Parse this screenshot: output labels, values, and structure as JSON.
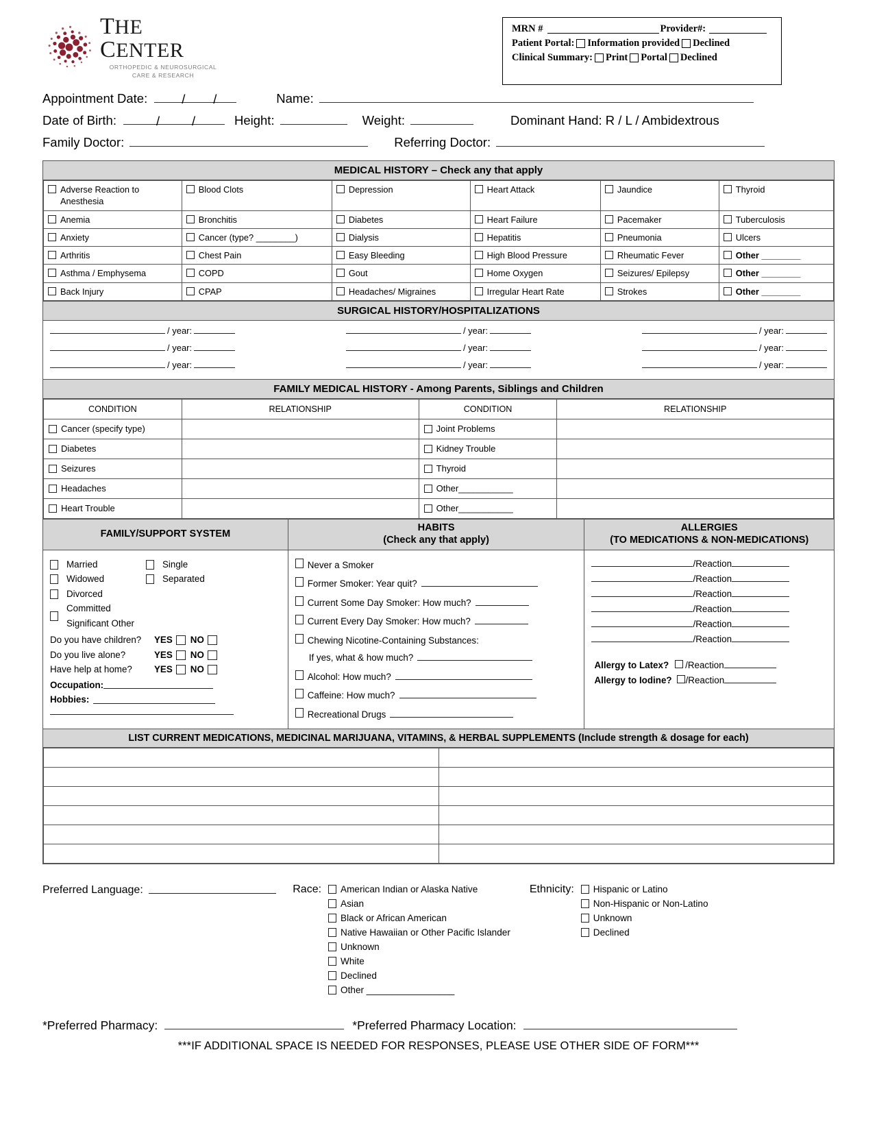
{
  "logo": {
    "title_the": "T",
    "title_he": "HE ",
    "title_c": "C",
    "title_enter": "ENTER",
    "title_full": "THE CENTER",
    "sub_line1": "ORTHOPEDIC & NEUROSURGICAL",
    "sub_line2": "CARE & RESEARCH"
  },
  "mrn_box": {
    "mrn_label": "MRN #",
    "provider_label": "Provider#:",
    "portal_label": "Patient Portal:",
    "portal_opt1": "Information provided",
    "portal_opt2": "Declined",
    "summary_label": "Clinical Summary:",
    "summary_opt1": "Print",
    "summary_opt2": "Portal",
    "summary_opt3": "Declined"
  },
  "patient_info": {
    "appointment_date": "Appointment Date:",
    "name": "Name:",
    "dob": "Date of Birth:",
    "height": "Height:",
    "weight": "Weight:",
    "dominant_hand": "Dominant Hand:  R  /  L  /  Ambidextrous",
    "family_doctor": "Family Doctor:",
    "referring_doctor": "Referring Doctor:"
  },
  "medical_history": {
    "title": "MEDICAL HISTORY – Check any that apply",
    "rows": [
      [
        "Adverse Reaction to Anesthesia",
        "Blood Clots",
        "Depression",
        "Heart Attack",
        "Jaundice",
        "Thyroid"
      ],
      [
        "Anemia",
        "Bronchitis",
        "Diabetes",
        "Heart Failure",
        "Pacemaker",
        "Tuberculosis"
      ],
      [
        "Anxiety",
        "Cancer (type? ________)",
        "Dialysis",
        "Hepatitis",
        "Pneumonia",
        "Ulcers"
      ],
      [
        "Arthritis",
        "Chest Pain",
        "Easy Bleeding",
        "High Blood Pressure",
        "Rheumatic Fever",
        "Other ________"
      ],
      [
        "Asthma / Emphysema",
        "COPD",
        "Gout",
        "Home Oxygen",
        "Seizures/ Epilepsy",
        "Other ________"
      ],
      [
        "Back Injury",
        "CPAP",
        "Headaches/ Migraines",
        "Irregular Heart Rate",
        "Strokes",
        "Other ________"
      ]
    ]
  },
  "surgical_history": {
    "title": "SURGICAL HISTORY/HOSPITALIZATIONS",
    "year_label": "/ year:",
    "rows": 3,
    "per_row": 3
  },
  "family_history": {
    "title": "FAMILY MEDICAL HISTORY - Among Parents, Siblings and Children",
    "header_condition": "CONDITION",
    "header_relationship": "RELATIONSHIP",
    "left_items": [
      "Cancer (specify  type)",
      "Diabetes",
      "Seizures",
      "Headaches",
      "Heart Trouble"
    ],
    "right_items": [
      "Joint Problems",
      "Kidney Trouble",
      "Thyroid",
      "Other___________",
      "Other___________"
    ]
  },
  "family_support": {
    "title": "FAMILY/SUPPORT SYSTEM",
    "status_left": [
      "Married",
      "Widowed",
      "Divorced",
      "Committed Significant Other"
    ],
    "status_right": [
      "Single",
      "Separated"
    ],
    "questions": [
      {
        "q": "Do you have children?",
        "yes": "YES",
        "no": "NO"
      },
      {
        "q": "Do you live alone?",
        "yes": "YES",
        "no": "NO"
      },
      {
        "q": "Have help at home?",
        "yes": "YES",
        "no": "NO"
      }
    ],
    "occupation": "Occupation:",
    "hobbies": "Hobbies:"
  },
  "habits": {
    "title_line1": "HABITS",
    "title_line2": "(Check any that apply)",
    "items": [
      {
        "label": "Never a Smoker",
        "checkbox": true,
        "blank": 0
      },
      {
        "label": "Former Smoker:  Year quit?",
        "checkbox": true,
        "blank": 170
      },
      {
        "label": "Current Some Day Smoker: How much?",
        "checkbox": true,
        "blank": 78
      },
      {
        "label": "Current Every Day Smoker: How much?",
        "checkbox": true,
        "blank": 78
      },
      {
        "label": "Chewing Nicotine-Containing Substances:",
        "checkbox": true,
        "blank": 0
      },
      {
        "label": "If yes, what & how much?",
        "checkbox": false,
        "blank": 168
      },
      {
        "label": "Alcohol:  How much?",
        "checkbox": true,
        "blank": 200
      },
      {
        "label": "Caffeine:  How much?",
        "checkbox": true,
        "blank": 200
      },
      {
        "label": "Recreational Drugs",
        "checkbox": true,
        "blank": 180
      }
    ]
  },
  "allergies": {
    "title_line1": "ALLERGIES",
    "title_line2": "(TO MEDICATIONS & NON-MEDICATIONS)",
    "reaction_label": "/Reaction",
    "reaction_rows": 6,
    "latex_label": "Allergy to Latex?",
    "iodine_label": "Allergy to Iodine?"
  },
  "medications": {
    "title": "LIST CURRENT MEDICATIONS, MEDICINAL MARIJUANA, VITAMINS, & HERBAL SUPPLEMENTS (Include strength & dosage for each)",
    "rows": 6,
    "cols": 2
  },
  "demographics": {
    "language_label": "Preferred Language:",
    "race_label": "Race:",
    "race_options": [
      "American Indian or Alaska Native",
      "Asian",
      "Black or African American",
      "Native Hawaiian or Other Pacific Islander",
      " Unknown",
      "White",
      "Declined",
      "Other _________________"
    ],
    "ethnicity_label": "Ethnicity:",
    "ethnicity_options": [
      "Hispanic or Latino",
      "Non-Hispanic or Non-Latino",
      " Unknown",
      "Declined"
    ]
  },
  "footer": {
    "pharmacy_label": "*Preferred Pharmacy:",
    "pharmacy_location_label": "*Preferred Pharmacy Location:",
    "note": "***IF ADDITIONAL SPACE IS NEEDED FOR RESPONSES, PLEASE USE OTHER SIDE OF FORM***"
  },
  "colors": {
    "bar_bg": "#d6d6d6",
    "border": "#555555",
    "logo_red": "#8c2030"
  }
}
